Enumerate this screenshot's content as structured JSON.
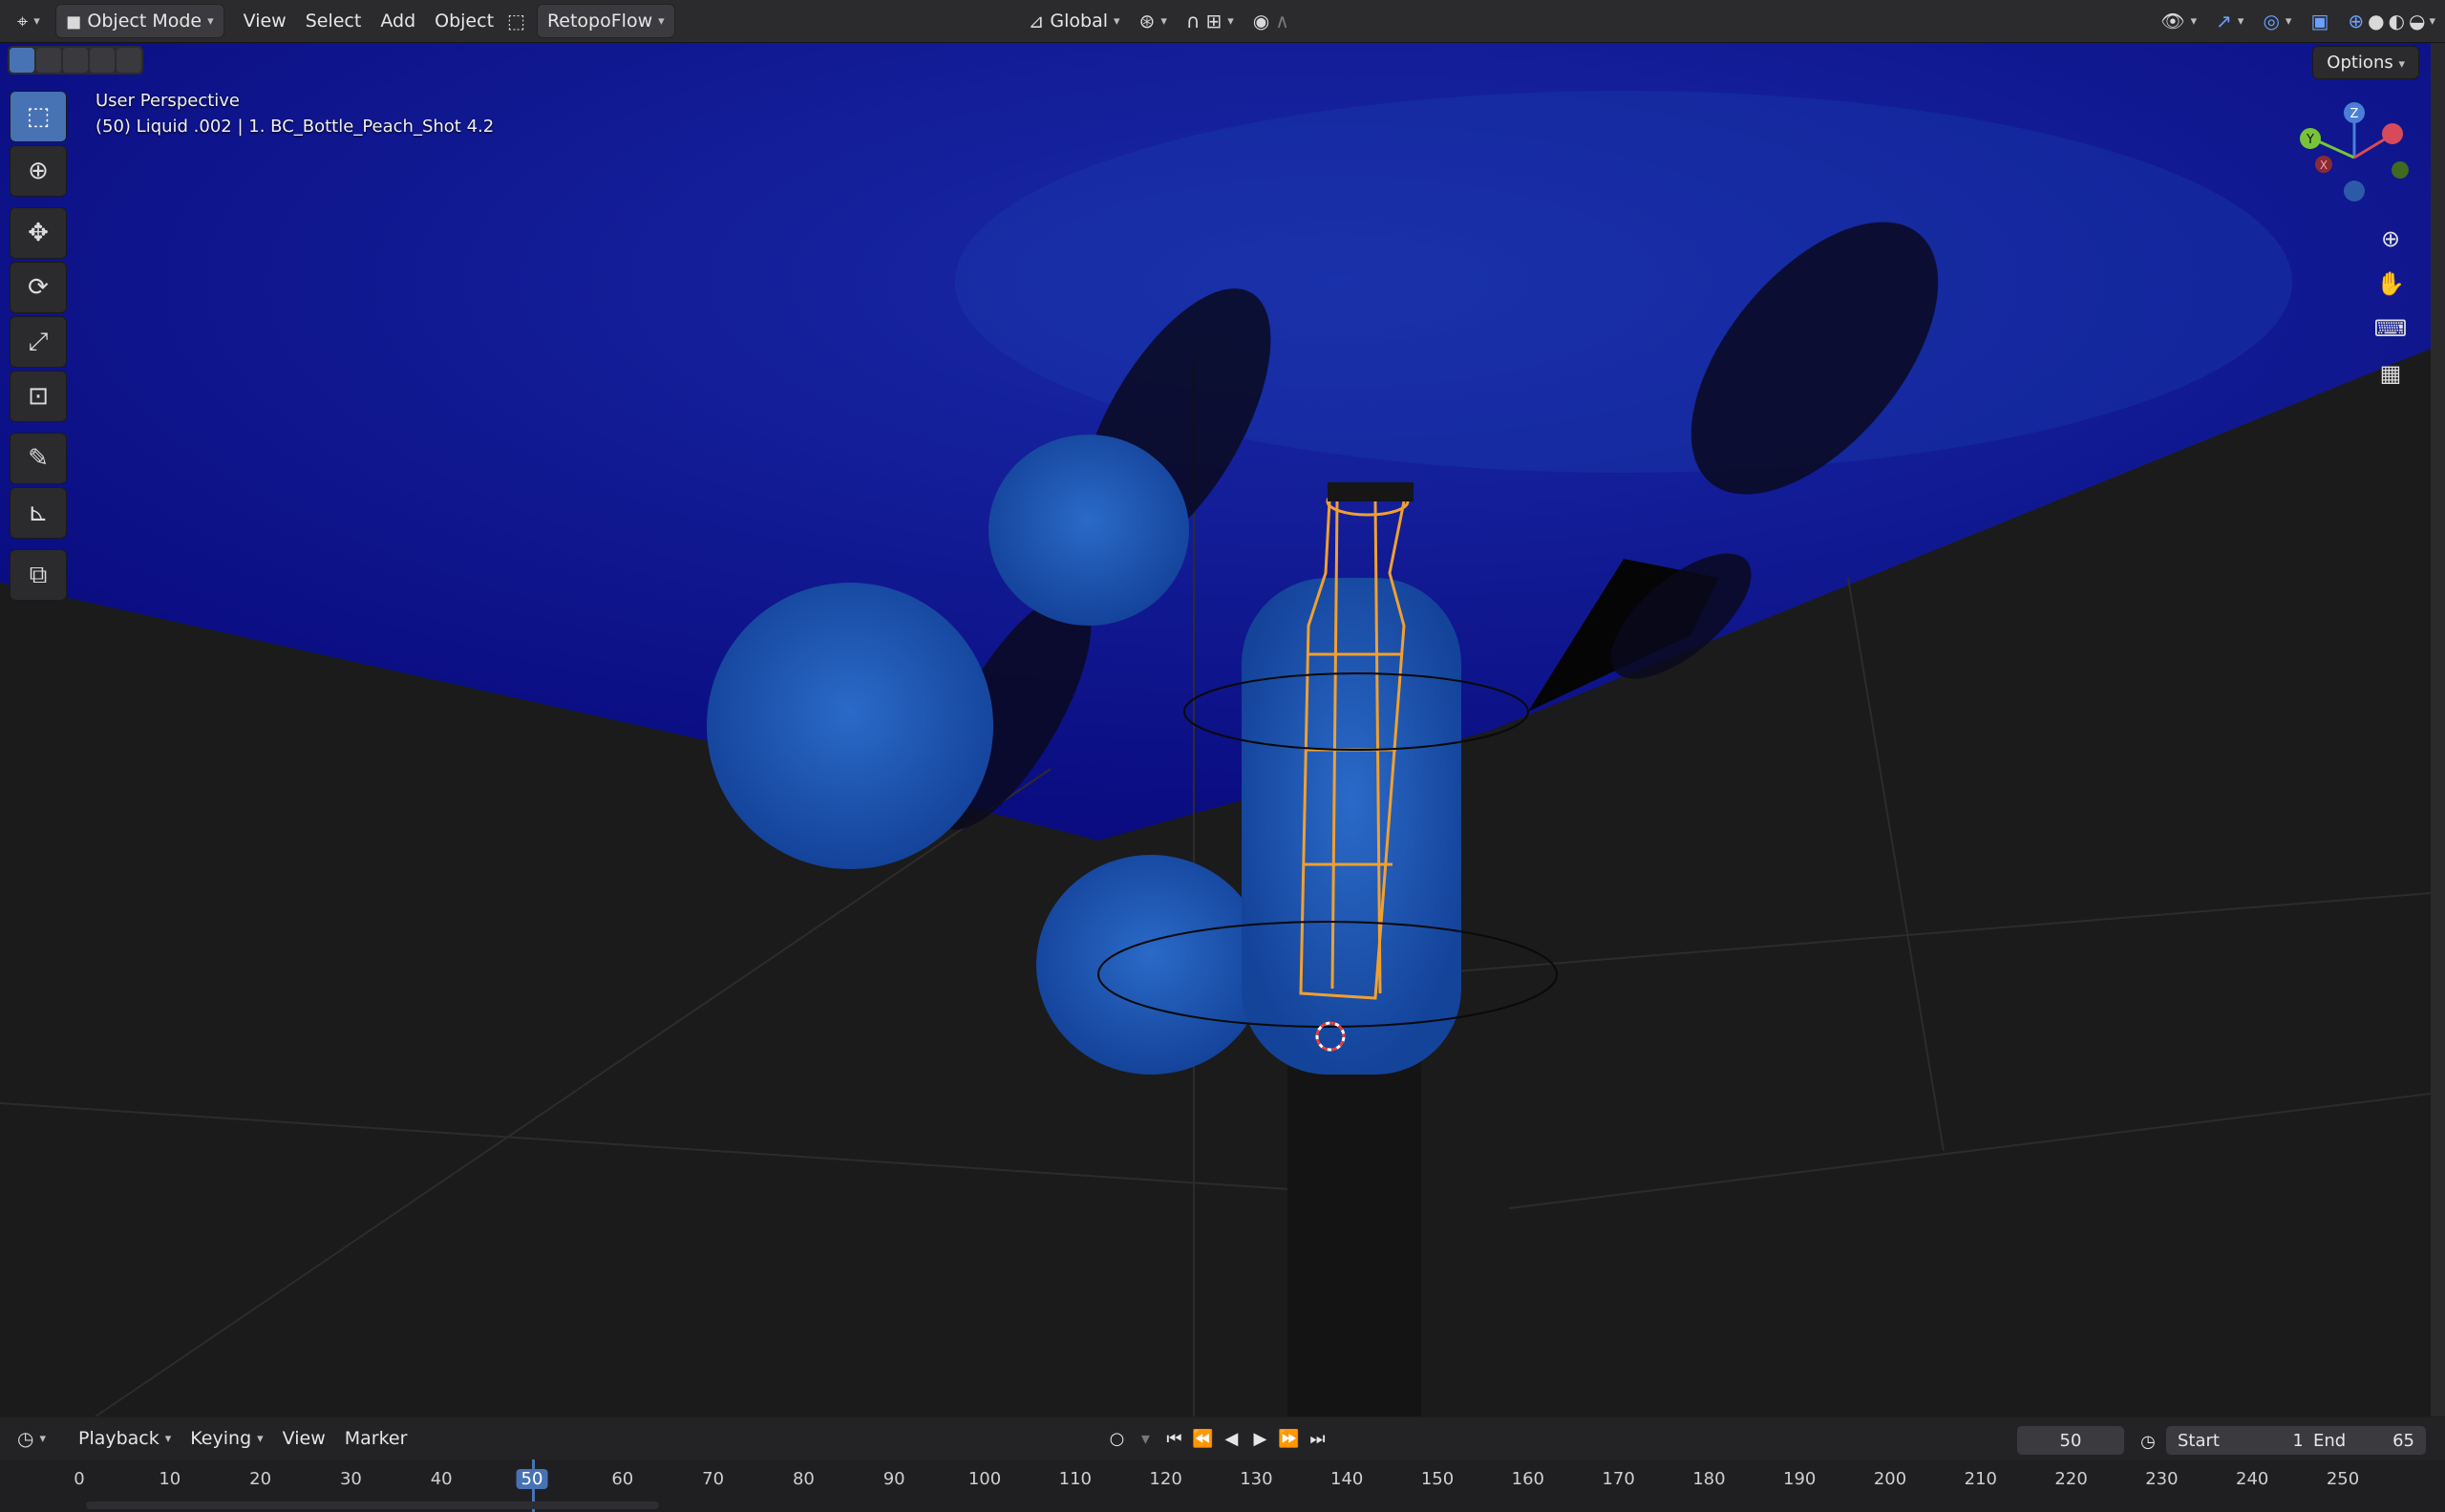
{
  "header": {
    "mode_label": "Object Mode",
    "menus": [
      "View",
      "Select",
      "Add",
      "Object"
    ],
    "addon_label": "RetopoFlow",
    "orientation_label": "Global"
  },
  "viewport": {
    "perspective_label": "User Perspective",
    "object_info": "(50) Liquid .002 | 1. BC_Bottle_Peach_Shot 4.2",
    "options_label": "Options",
    "gizmo": {
      "z": "Z",
      "y": "Y",
      "x": "X"
    }
  },
  "timeline": {
    "menus": [
      "Playback",
      "Keying",
      "View",
      "Marker"
    ],
    "current_frame": "50",
    "start_label": "Start",
    "start_value": "1",
    "end_label": "End",
    "end_value": "65",
    "ticks": [
      "0",
      "10",
      "20",
      "30",
      "40",
      "50",
      "60",
      "70",
      "80",
      "90",
      "100",
      "110",
      "120",
      "130",
      "140",
      "150",
      "160",
      "170",
      "180",
      "190",
      "200",
      "210",
      "220",
      "230",
      "240",
      "250"
    ]
  },
  "colors": {
    "accent": "#4772b3",
    "sky": "#0a0a8a",
    "liquid": "#1d4fb0",
    "selection_wire": "#f0a030"
  }
}
